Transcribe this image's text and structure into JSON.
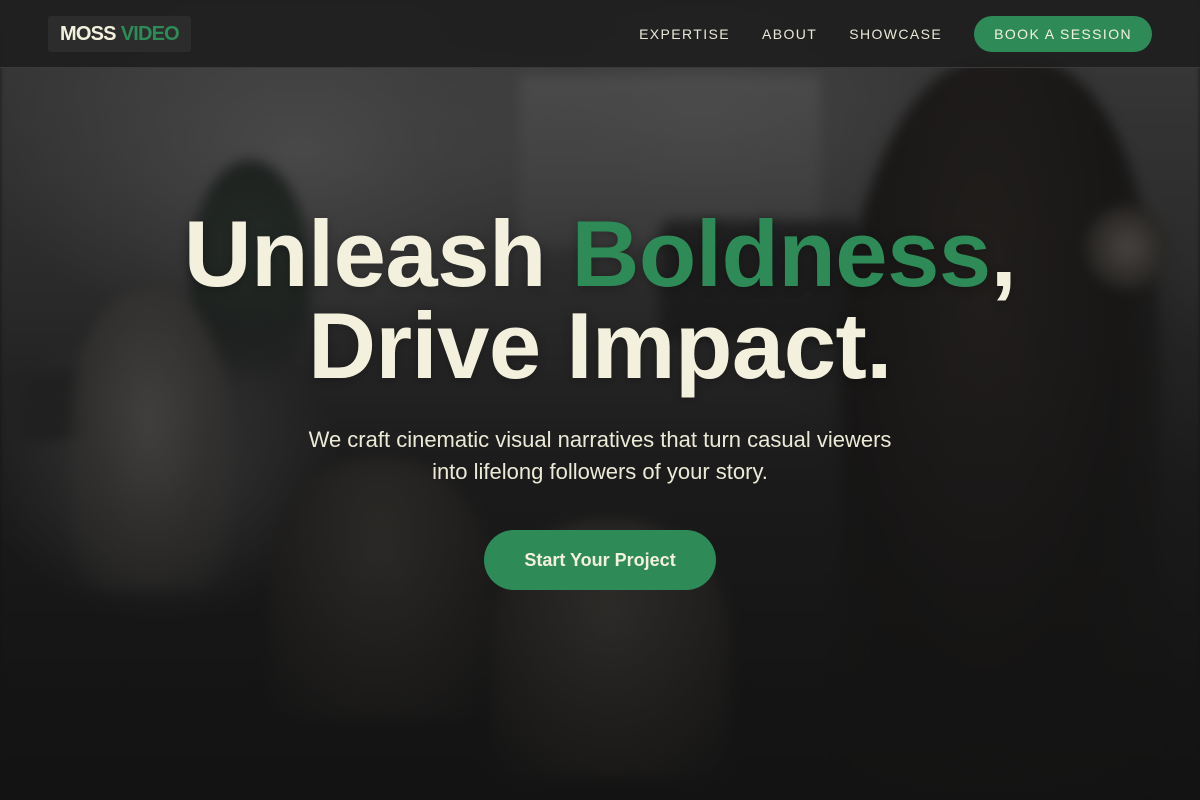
{
  "brand": {
    "word1": "MOSS",
    "word2": "VIDEO"
  },
  "nav": {
    "links": [
      "EXPERTISE",
      "ABOUT",
      "SHOWCASE"
    ],
    "cta_label": "BOOK A SESSION"
  },
  "hero": {
    "headline_word1": "Unleash",
    "headline_accent": "Boldness",
    "headline_comma": ",",
    "headline_line2": "Drive Impact.",
    "subtitle_line1": "We craft cinematic visual narratives that turn casual viewers",
    "subtitle_line2": "into lifelong followers of your story.",
    "cta_label": "Start Your Project"
  },
  "colors": {
    "accent": "#2e8b57",
    "cream": "#f3f1de",
    "navbar": "#1e1e1e"
  }
}
